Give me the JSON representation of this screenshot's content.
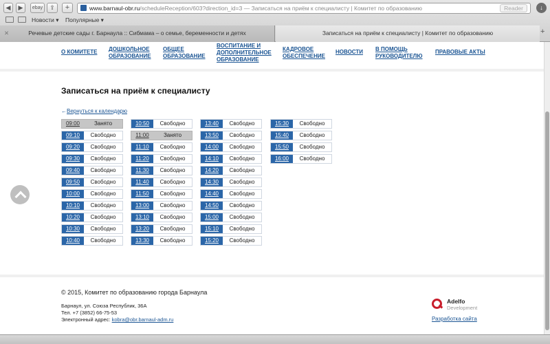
{
  "browser": {
    "url_host": "www.barnaul-obr.ru",
    "url_path": "/scheduleReception/603?direction_id=3",
    "url_title": "Записаться на приём к специалисту | Комитет по образованию",
    "url_separator": "—",
    "reader_label": "Reader",
    "nav_button_label": "ebay",
    "bookmarks": [
      "Новости ▾",
      "Популярные ▾"
    ],
    "tabs": [
      {
        "label": "Речевые детские сады г. Барнаула :: Сибмама – о семье, беременности и детях",
        "close": "✕"
      },
      {
        "label": "Записаться на приём к специалисту | Комитет по образованию"
      }
    ],
    "new_tab": "+"
  },
  "nav": [
    "О КОМИТЕТЕ",
    "ДОШКОЛЬНОЕ ОБРАЗОВАНИЕ",
    "ОБЩЕЕ ОБРАЗОВАНИЕ",
    "ВОСПИТАНИЕ И ДОПОЛНИТЕЛЬНОЕ ОБРАЗОВАНИЕ",
    "КАДРОВОЕ ОБЕСПЕЧЕНИЕ",
    "НОВОСТИ",
    "В ПОМОЩЬ РУКОВОДИТЕЛЮ",
    "ПРАВОВЫЕ АКТЫ"
  ],
  "page_title": "Записаться на приём к специалисту",
  "back_link": {
    "arrow": "←",
    "label": "Вернуться к календарю"
  },
  "status": {
    "free": "Свободно",
    "busy": "Занято"
  },
  "slots": [
    [
      {
        "time": "09:00",
        "busy": true
      },
      {
        "time": "09:10",
        "busy": false
      },
      {
        "time": "09:20",
        "busy": false
      },
      {
        "time": "09:30",
        "busy": false
      },
      {
        "time": "09:40",
        "busy": false
      },
      {
        "time": "09:50",
        "busy": false
      },
      {
        "time": "10:00",
        "busy": false
      },
      {
        "time": "10:10",
        "busy": false
      },
      {
        "time": "10:20",
        "busy": false
      },
      {
        "time": "10:30",
        "busy": false
      },
      {
        "time": "10:40",
        "busy": false
      }
    ],
    [
      {
        "time": "10:50",
        "busy": false
      },
      {
        "time": "11:00",
        "busy": true
      },
      {
        "time": "11:10",
        "busy": false
      },
      {
        "time": "11:20",
        "busy": false
      },
      {
        "time": "11:30",
        "busy": false
      },
      {
        "time": "11:40",
        "busy": false
      },
      {
        "time": "11:50",
        "busy": false
      },
      {
        "time": "13:00",
        "busy": false
      },
      {
        "time": "13:10",
        "busy": false
      },
      {
        "time": "13:20",
        "busy": false
      },
      {
        "time": "13:30",
        "busy": false
      }
    ],
    [
      {
        "time": "13:40",
        "busy": false
      },
      {
        "time": "13:50",
        "busy": false
      },
      {
        "time": "14:00",
        "busy": false
      },
      {
        "time": "14:10",
        "busy": false
      },
      {
        "time": "14:20",
        "busy": false
      },
      {
        "time": "14:30",
        "busy": false
      },
      {
        "time": "14:40",
        "busy": false
      },
      {
        "time": "14:50",
        "busy": false
      },
      {
        "time": "15:00",
        "busy": false
      },
      {
        "time": "15:10",
        "busy": false
      },
      {
        "time": "15:20",
        "busy": false
      }
    ],
    [
      {
        "time": "15:30",
        "busy": false
      },
      {
        "time": "15:40",
        "busy": false
      },
      {
        "time": "15:50",
        "busy": false
      },
      {
        "time": "16:00",
        "busy": false
      }
    ]
  ],
  "footer": {
    "copyright": "© 2015, Комитет по образованию города Барнаула",
    "address": "Барнаул, ул. Союза Республик, 36А",
    "phone": "Тел. +7 (3852) 66-75-53",
    "email_label": "Электронный адрес:",
    "email": "kobra@obr.barnaul-adm.ru",
    "logo_brand": "Adelfo",
    "logo_sub": "Development",
    "dev_link": "Разработка сайта"
  },
  "colors": {
    "accent": "#2b66a8",
    "link": "#1a5493",
    "busy": "#c6c6c6",
    "logo": "#c81e2c"
  }
}
